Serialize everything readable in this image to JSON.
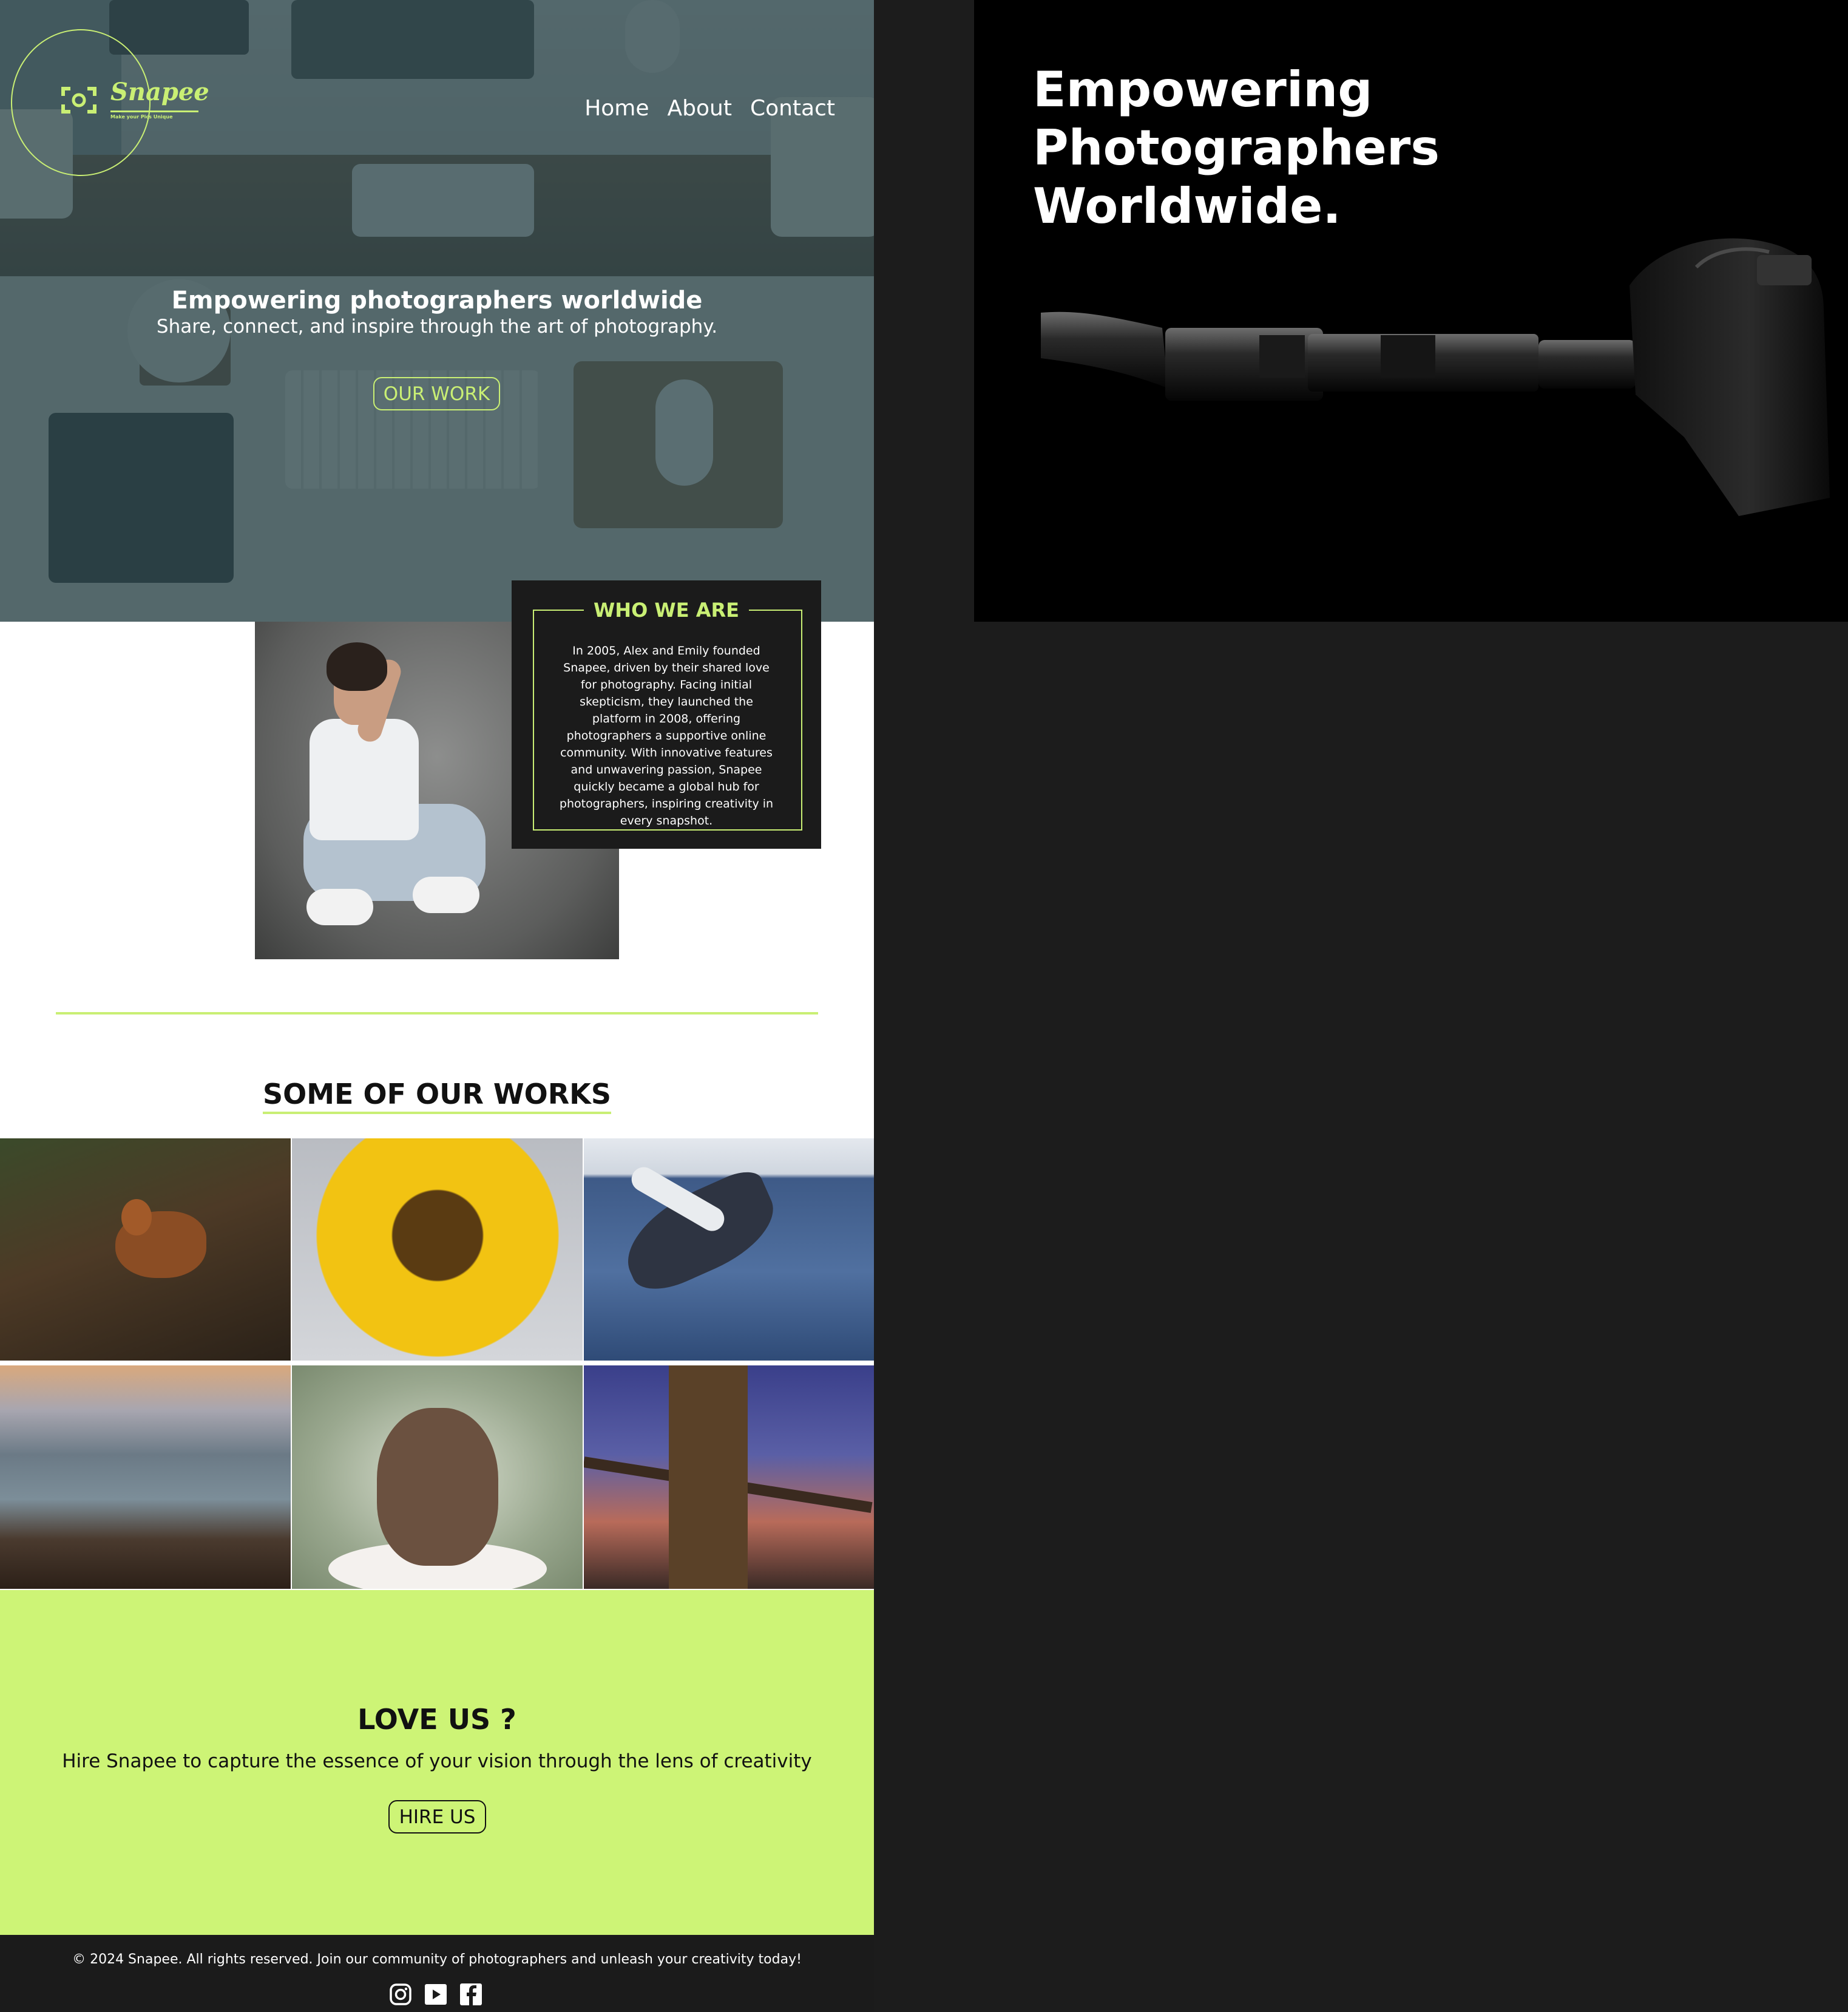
{
  "brand": {
    "name": "Snapee",
    "tagline": "Make your Pics Unique",
    "accent": "#c9ef74",
    "accent_bg": "#cdf476",
    "dark": "#1b1b1b"
  },
  "nav": {
    "items": [
      "Home",
      "About",
      "Contact"
    ]
  },
  "hero": {
    "title": "Empowering photographers worldwide",
    "subtitle": "Share, connect, and inspire through the art of photography.",
    "cta": "OUR WORK"
  },
  "who": {
    "title": "WHO WE ARE",
    "text": "In 2005, Alex and Emily founded Snapee, driven by their shared love for photography. Facing initial skepticism, they launched the platform in 2008, offering photographers a supportive online community. With innovative features and unwavering passion, Snapee quickly became a global hub for photographers, inspiring creativity in every snapshot."
  },
  "works": {
    "title": "SOME OF OUR WORKS",
    "images": [
      "fox",
      "sunflower",
      "whale",
      "coast",
      "owl",
      "bridge"
    ]
  },
  "love": {
    "title": "LOVE US ?",
    "subtitle": "Hire Snapee to capture the essence of your vision through the lens of creativity",
    "cta": "HIRE US"
  },
  "footer": {
    "text": "© 2024 Snapee. All rights reserved. Join our community of photographers and unleash your creativity today!",
    "socials": [
      "instagram-icon",
      "youtube-icon",
      "facebook-icon"
    ]
  },
  "right_panel": {
    "title": "Empowering\nPhotographers\nWorldwide."
  }
}
